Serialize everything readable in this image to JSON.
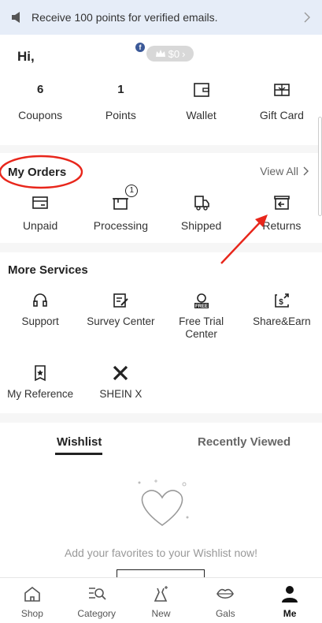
{
  "banner": {
    "text": "Receive 100 points for verified emails."
  },
  "profile": {
    "greeting": "Hi,",
    "fb_badge": "f",
    "pill_amount": "$0"
  },
  "stats": [
    {
      "value": "6",
      "label": "Coupons"
    },
    {
      "value": "1",
      "label": "Points"
    },
    {
      "label": "Wallet",
      "icon": "wallet-icon"
    },
    {
      "label": "Gift Card",
      "icon": "gift-card-icon"
    }
  ],
  "orders": {
    "title": "My Orders",
    "view_all": "View All",
    "items": [
      {
        "label": "Unpaid",
        "icon": "unpaid-icon"
      },
      {
        "label": "Processing",
        "icon": "processing-icon",
        "badge": "1"
      },
      {
        "label": "Shipped",
        "icon": "truck-icon"
      },
      {
        "label": "Returns",
        "icon": "returns-icon"
      }
    ]
  },
  "services": {
    "title": "More Services",
    "items": [
      {
        "label": "Support",
        "icon": "headset-icon"
      },
      {
        "label": "Survey Center",
        "icon": "survey-icon"
      },
      {
        "label": "Free Trial Center",
        "icon": "free-trial-icon",
        "badge_text": "FREE"
      },
      {
        "label": "Share&Earn",
        "icon": "share-earn-icon"
      },
      {
        "label": "My Reference",
        "icon": "reference-icon"
      },
      {
        "label": "SHEIN X",
        "icon": "shein-x-icon"
      }
    ]
  },
  "wishlist": {
    "tabs": [
      "Wishlist",
      "Recently Viewed"
    ],
    "empty_text": "Add your favorites to your Wishlist now!"
  },
  "nav": [
    {
      "label": "Shop",
      "icon": "home-icon"
    },
    {
      "label": "Category",
      "icon": "category-search-icon"
    },
    {
      "label": "New",
      "icon": "sparkle-dress-icon"
    },
    {
      "label": "Gals",
      "icon": "lips-icon"
    },
    {
      "label": "Me",
      "icon": "person-icon",
      "active": true
    }
  ],
  "colors": {
    "banner_bg": "#e6edf8",
    "annotation_red": "#e8261b",
    "fb_blue": "#3b5998"
  }
}
